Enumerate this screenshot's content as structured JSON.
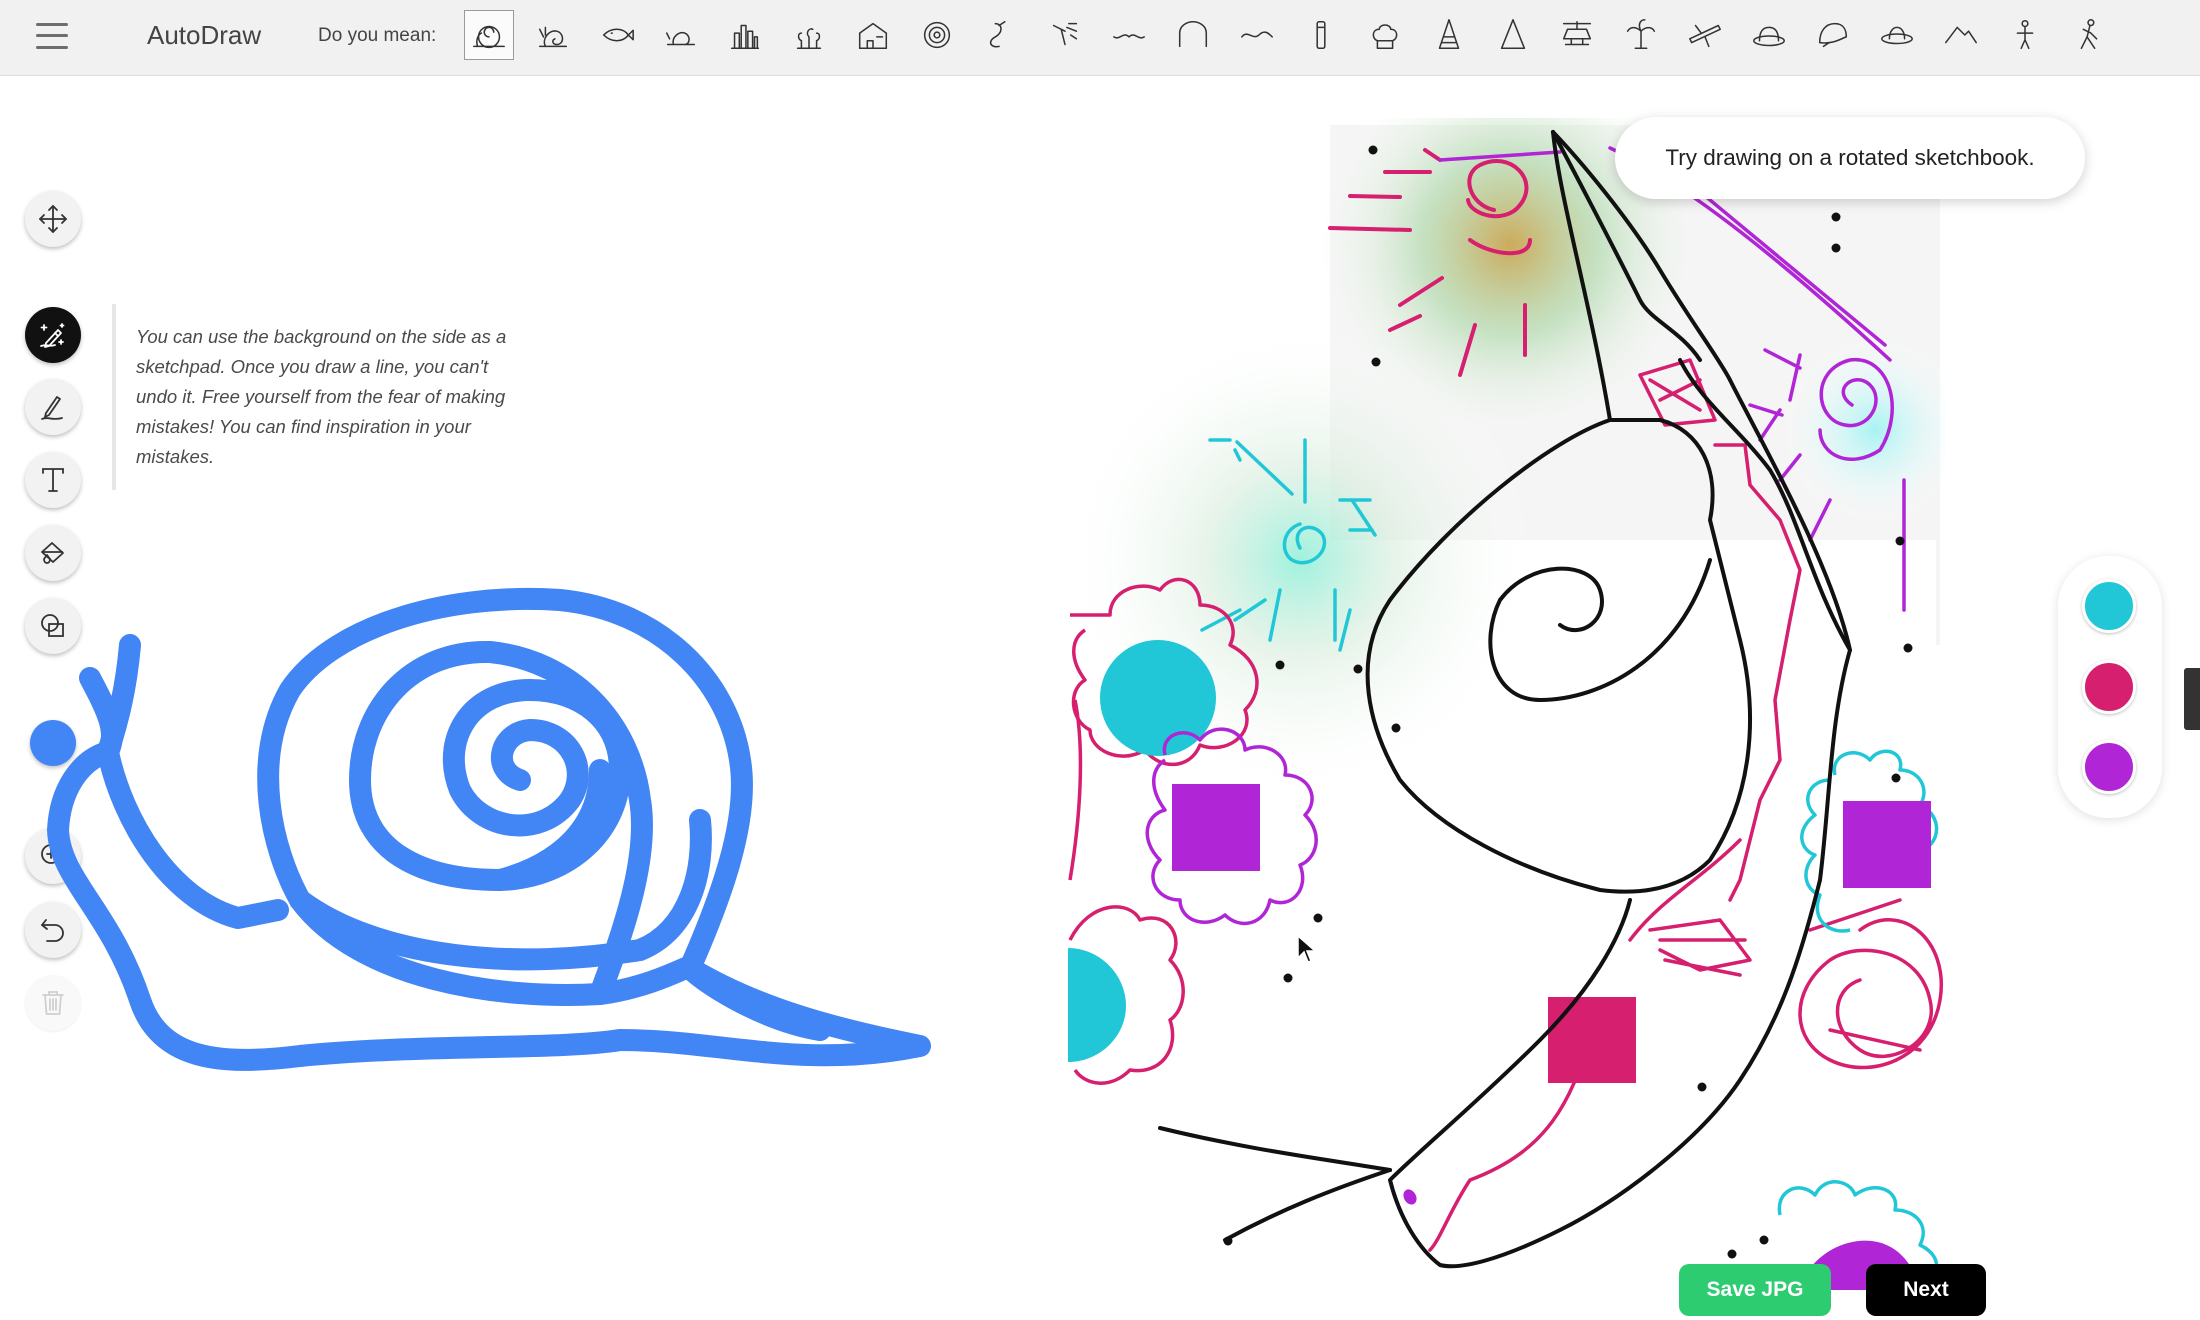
{
  "app": {
    "title": "AutoDraw"
  },
  "suggestions": {
    "label": "Do you mean:",
    "items": [
      {
        "name": "snail-shell-icon",
        "selected": true
      },
      {
        "name": "snail-icon"
      },
      {
        "name": "fish-icon"
      },
      {
        "name": "snail-small-icon"
      },
      {
        "name": "city-skyline-icon"
      },
      {
        "name": "plants-icon"
      },
      {
        "name": "house-icon"
      },
      {
        "name": "target-icon"
      },
      {
        "name": "hook-icon"
      },
      {
        "name": "sprinkler-icon"
      },
      {
        "name": "mustache-icon"
      },
      {
        "name": "arch-icon"
      },
      {
        "name": "squiggle-icon"
      },
      {
        "name": "tube-icon"
      },
      {
        "name": "chef-hat-icon"
      },
      {
        "name": "party-hat-icon"
      },
      {
        "name": "cone-icon"
      },
      {
        "name": "helicopter-icon"
      },
      {
        "name": "palm-tree-icon"
      },
      {
        "name": "airplane-icon"
      },
      {
        "name": "hat-icon"
      },
      {
        "name": "helmet-icon"
      },
      {
        "name": "cowboy-hat-icon"
      },
      {
        "name": "mountain-icon"
      },
      {
        "name": "person-icon"
      },
      {
        "name": "walking-person-icon"
      }
    ]
  },
  "tools": [
    {
      "name": "move-tool-button",
      "icon": "move-icon"
    },
    {
      "name": "autodraw-tool-button",
      "icon": "autodraw-icon",
      "active": true
    },
    {
      "name": "draw-tool-button",
      "icon": "pencil-icon"
    },
    {
      "name": "type-tool-button",
      "icon": "text-icon"
    },
    {
      "name": "fill-tool-button",
      "icon": "fill-bucket-icon"
    },
    {
      "name": "shape-tool-button",
      "icon": "shapes-icon"
    }
  ],
  "current_color": "#4285f4",
  "tip": {
    "text": "You can use the background on the side as a sketchpad. Once you draw a line, you can't undo it. Free yourself from the fear of making mistakes! You can find inspiration in your mistakes."
  },
  "toast": {
    "text": "Try drawing on a rotated sketchbook."
  },
  "palette": {
    "colors": [
      "#21c7d6",
      "#d61f6e",
      "#b025d6"
    ]
  },
  "buttons": {
    "save": "Save JPG",
    "next": "Next"
  }
}
